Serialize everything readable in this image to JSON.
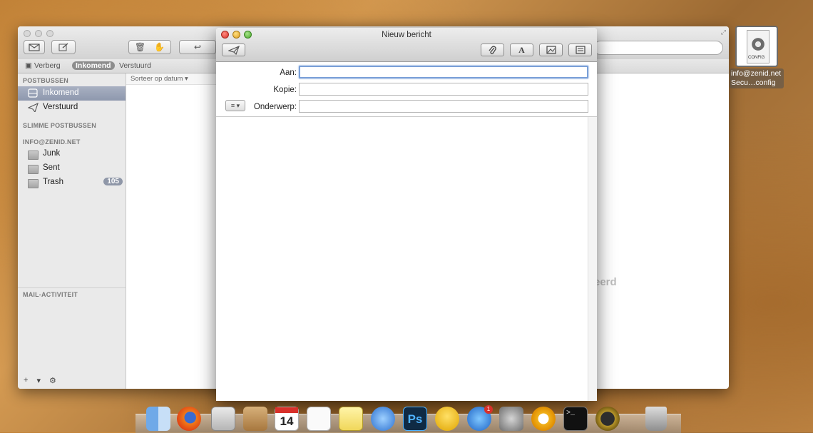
{
  "mail_window": {
    "favorites": {
      "hide_label": "Verberg",
      "inbox_label": "Inkomend",
      "sent_label": "Verstuurd"
    },
    "sidebar": {
      "mailboxes_header": "POSTBUSSEN",
      "mailboxes": [
        {
          "label": "Inkomend",
          "selected": true
        },
        {
          "label": "Verstuurd",
          "selected": false
        }
      ],
      "smart_mailboxes_header": "SLIMME POSTBUSSEN",
      "account_header": "INFO@ZENID.NET",
      "account_folders": [
        {
          "label": "Junk"
        },
        {
          "label": "Sent"
        },
        {
          "label": "Trash",
          "badge": "105"
        }
      ],
      "activity_header": "MAIL-ACTIVITEIT",
      "bottom_actions": {
        "add": "+",
        "hide": "▾",
        "gear": "⚙"
      }
    },
    "message_list": {
      "sort_label": "Sorteer op datum ▾"
    },
    "viewer": {
      "no_message_fragment": "eerd"
    }
  },
  "compose": {
    "title": "Nieuw bericht",
    "fields": {
      "to_label": "Aan:",
      "to_value": "",
      "cc_label": "Kopie:",
      "cc_value": "",
      "subject_label": "Onderwerp:",
      "subject_value": "",
      "format_menu": "≡ ▾"
    },
    "toolbar": {
      "send_icon": "send-icon",
      "attach_icon": "paperclip-icon",
      "font_label": "A",
      "photo_icon": "photo-icon",
      "template_icon": "template-icon"
    }
  },
  "desktop_file": {
    "label": "info@zenid.net Secu…config",
    "icon_text": "CONFIG"
  },
  "dock": {
    "calendar_day": "14",
    "app_store_badge": "1"
  },
  "colors": {
    "selection": "#8e98ae",
    "focus_ring": "#7aa0d8",
    "close": "#d8302a",
    "minimize": "#dd9b1d",
    "zoom": "#4ba72d"
  }
}
